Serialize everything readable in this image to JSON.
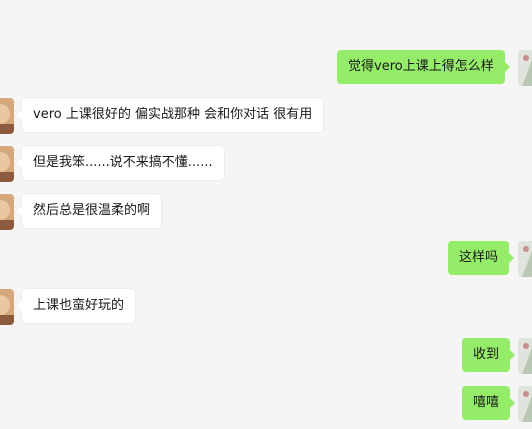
{
  "chat": {
    "messages": [
      {
        "side": "right",
        "text": "觉得vero上课上得怎么样"
      },
      {
        "side": "left",
        "text": "vero 上课很好的 偏实战那种 会和你对话 很有用"
      },
      {
        "side": "left",
        "text": "但是我笨......说不来搞不懂......"
      },
      {
        "side": "left",
        "text": "然后总是很温柔的啊"
      },
      {
        "side": "right",
        "text": "这样吗"
      },
      {
        "side": "left",
        "text": "上课也蛮好玩的"
      },
      {
        "side": "right",
        "text": "收到"
      },
      {
        "side": "right",
        "text": "嘻嘻"
      }
    ]
  },
  "colors": {
    "background": "#f5f5f5",
    "outgoing_bubble": "#95ec69",
    "incoming_bubble": "#ffffff"
  },
  "icons": {
    "contact_avatar": "contact-avatar-icon",
    "self_avatar": "self-avatar-icon"
  }
}
